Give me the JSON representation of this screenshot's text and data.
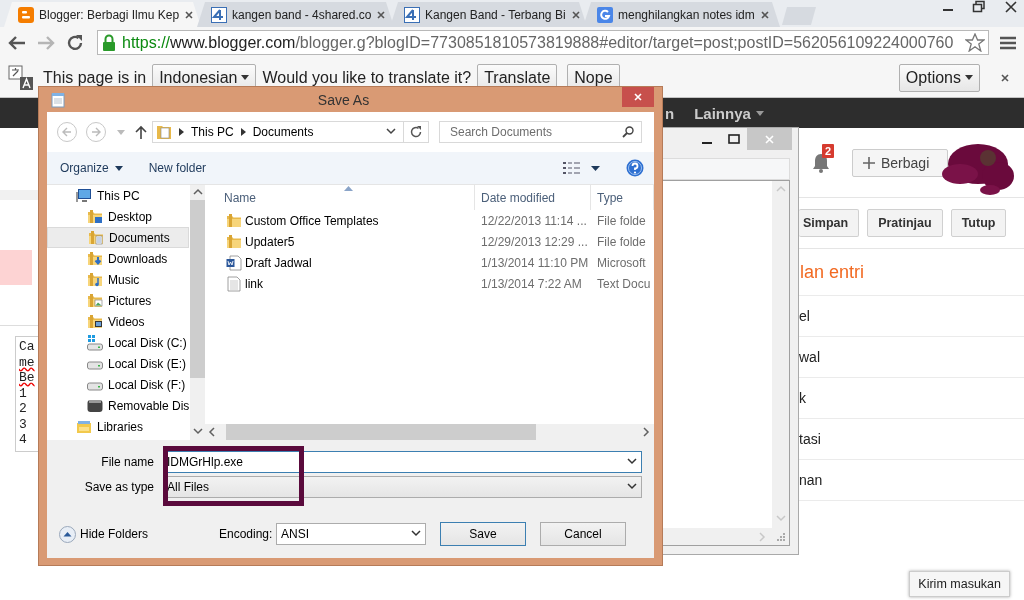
{
  "browser": {
    "tabs": [
      {
        "title": "Blogger: Berbagi Ilmu Kep",
        "kind": "blogger",
        "selected": true
      },
      {
        "title": "kangen band - 4shared.co",
        "kind": "four",
        "selected": false
      },
      {
        "title": "Kangen Band - Terbang Bi",
        "kind": "four",
        "selected": false
      },
      {
        "title": "menghilangkan notes idm",
        "kind": "google",
        "selected": false
      }
    ],
    "address": {
      "scheme": "https://",
      "host": "www.blogger.com",
      "path": "/blogger.g?blogID=7730851810573819888#editor/target=post;postID=562056109224000760"
    },
    "translate_bar": {
      "message": "This page is in",
      "language": "Indonesian",
      "question": "Would you like to translate it?",
      "translate_button": "Translate",
      "nope_button": "Nope",
      "options_button": "Options"
    }
  },
  "blogger": {
    "menu_items": [
      "n",
      "Lainnya"
    ],
    "notification_count": "2",
    "share_button": "Berbagi",
    "action_buttons": [
      "Simpan",
      "Pratinjau",
      "Tutup"
    ],
    "settings_heading": "lan entri",
    "settings_items": [
      "el",
      "wal",
      "k",
      "tasi",
      "nan"
    ],
    "editor_lines": [
      {
        "text": "Ca",
        "misspelled": false
      },
      {
        "text": "me",
        "misspelled": true
      },
      {
        "text": "Be",
        "misspelled": true
      },
      {
        "text": "1",
        "misspelled": false
      },
      {
        "text": "2",
        "misspelled": false
      },
      {
        "text": "3",
        "misspelled": false
      },
      {
        "text": "4",
        "misspelled": false
      }
    ],
    "feedback_button": "Kirim masukan"
  },
  "save_dialog": {
    "title": "Save As",
    "breadcrumb": [
      "This PC",
      "Documents"
    ],
    "search_placeholder": "Search Documents",
    "organize_button": "Organize",
    "new_folder_button": "New folder",
    "tree": [
      {
        "label": "This PC",
        "kind": "pc",
        "selected": false,
        "children": [
          {
            "label": "Desktop",
            "kind": "desktop",
            "selected": false
          },
          {
            "label": "Documents",
            "kind": "documents",
            "selected": true
          },
          {
            "label": "Downloads",
            "kind": "downloads",
            "selected": false
          },
          {
            "label": "Music",
            "kind": "music",
            "selected": false
          },
          {
            "label": "Pictures",
            "kind": "pictures",
            "selected": false
          },
          {
            "label": "Videos",
            "kind": "videos",
            "selected": false
          },
          {
            "label": "Local Disk (C:)",
            "kind": "system-drive",
            "selected": false
          },
          {
            "label": "Local Disk (E:)",
            "kind": "drive",
            "selected": false
          },
          {
            "label": "Local Disk (F:)",
            "kind": "drive",
            "selected": false
          },
          {
            "label": "Removable Dis",
            "kind": "removable",
            "selected": false
          }
        ]
      },
      {
        "label": "Libraries",
        "kind": "library",
        "selected": false
      }
    ],
    "columns": [
      "Name",
      "Date modified",
      "Type"
    ],
    "files": [
      {
        "name": "Custom Office Templates",
        "date": "12/22/2013 11:14 ...",
        "type": "File folde",
        "kind": "folder"
      },
      {
        "name": "Updater5",
        "date": "12/29/2013 12:29 ...",
        "type": "File folde",
        "kind": "folder"
      },
      {
        "name": "Draft Jadwal",
        "date": "1/13/2014 11:10 PM",
        "type": "Microsoft",
        "kind": "word"
      },
      {
        "name": "link",
        "date": "1/13/2014 7:22 AM",
        "type": "Text Docu",
        "kind": "text"
      }
    ],
    "file_name_label": "File name",
    "file_name": "IDMGrHlp.exe",
    "type_label": "Save as type",
    "file_type": "All Files",
    "hide_folders": "Hide Folders",
    "encoding_label": "Encoding:",
    "encoding": "ANSI",
    "save_button": "Save",
    "cancel_button": "Cancel"
  }
}
